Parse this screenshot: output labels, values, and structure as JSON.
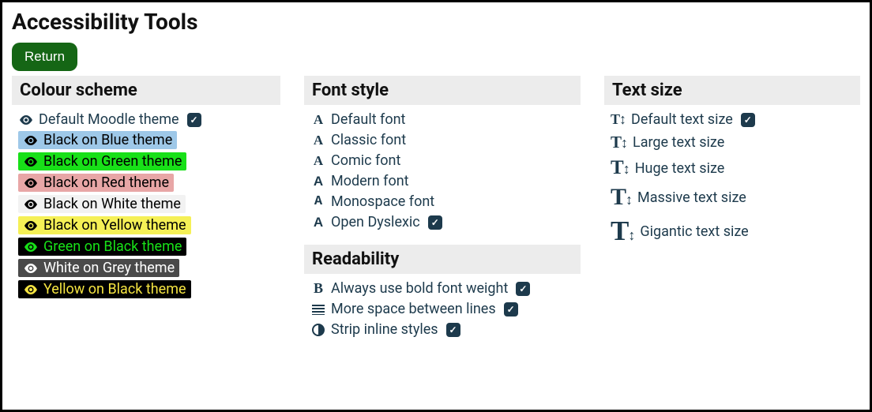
{
  "page_title": "Accessibility Tools",
  "return_label": "Return",
  "sections": {
    "colour": {
      "heading": "Colour scheme",
      "items": [
        {
          "key": "default",
          "label": "Default Moodle theme",
          "checked": true
        },
        {
          "key": "blue",
          "label": "Black on Blue theme",
          "checked": false
        },
        {
          "key": "green",
          "label": "Black on Green theme",
          "checked": false
        },
        {
          "key": "red",
          "label": "Black on Red theme",
          "checked": false
        },
        {
          "key": "white",
          "label": "Black on White theme",
          "checked": false
        },
        {
          "key": "yellow",
          "label": "Black on Yellow theme",
          "checked": false
        },
        {
          "key": "gblack",
          "label": "Green on Black theme",
          "checked": false
        },
        {
          "key": "wgrey",
          "label": "White on Grey theme",
          "checked": false
        },
        {
          "key": "yblack",
          "label": "Yellow on Black theme",
          "checked": false
        }
      ]
    },
    "font": {
      "heading": "Font style",
      "items": [
        {
          "key": "default",
          "label": "Default font",
          "checked": false
        },
        {
          "key": "classic",
          "label": "Classic font",
          "checked": false
        },
        {
          "key": "comic",
          "label": "Comic font",
          "checked": false
        },
        {
          "key": "modern",
          "label": "Modern font",
          "checked": false
        },
        {
          "key": "monospace",
          "label": "Monospace font",
          "checked": false
        },
        {
          "key": "dyslexic",
          "label": "Open Dyslexic",
          "checked": true
        }
      ]
    },
    "readability": {
      "heading": "Readability",
      "items": [
        {
          "key": "bold",
          "label": "Always use bold font weight",
          "checked": true
        },
        {
          "key": "lines",
          "label": "More space between lines",
          "checked": true
        },
        {
          "key": "strip",
          "label": "Strip inline styles",
          "checked": true
        }
      ]
    },
    "textsize": {
      "heading": "Text size",
      "items": [
        {
          "key": "default",
          "label": "Default text size",
          "checked": true
        },
        {
          "key": "large",
          "label": "Large text size",
          "checked": false
        },
        {
          "key": "huge",
          "label": "Huge text size",
          "checked": false
        },
        {
          "key": "massive",
          "label": "Massive text size",
          "checked": false
        },
        {
          "key": "gigantic",
          "label": "Gigantic text size",
          "checked": false
        }
      ]
    }
  }
}
